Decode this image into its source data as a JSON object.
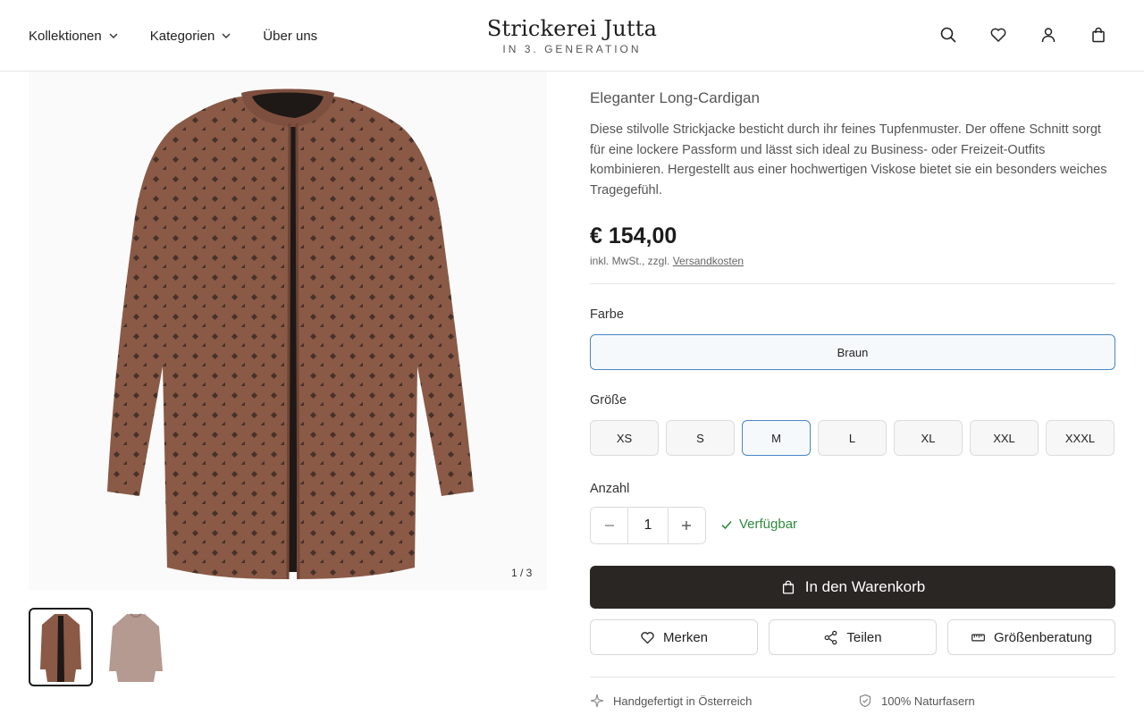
{
  "header": {
    "nav": [
      {
        "label": "Kollektionen",
        "has_dropdown": true
      },
      {
        "label": "Kategorien",
        "has_dropdown": true
      },
      {
        "label": "Über uns",
        "has_dropdown": false
      }
    ],
    "brand_name": "Strickerei Jutta",
    "brand_tagline": "IN 3. GENERATION",
    "icons": [
      "search-icon",
      "heart-icon",
      "user-icon",
      "shopping-bag-icon"
    ]
  },
  "gallery": {
    "counter": "1 / 3",
    "thumbnails": [
      {
        "icon": "cardigan-brown-thumbnail",
        "active": true
      },
      {
        "icon": "cardigan-beige-thumbnail",
        "active": false
      }
    ]
  },
  "product": {
    "subtitle": "Eleganter Long-Cardigan",
    "description": "Diese stilvolle Strickjacke besticht durch ihr feines Tupfenmuster. Der offene Schnitt sorgt für eine lockere Passform und lässt sich ideal zu Business- oder Freizeit-Outfits kombinieren. Hergestellt aus einer hochwertigen Viskose bietet sie ein besonders weiches Tragegefühl.",
    "price": "€ 154,00",
    "tax_note": "inkl. MwSt., zzgl.",
    "shipping_link": "Versandkosten",
    "color_label": "Farbe",
    "color_value": "Braun",
    "size_label": "Größe",
    "sizes": [
      "XS",
      "S",
      "M",
      "L",
      "XL",
      "XXL",
      "XXXL"
    ],
    "selected_size": "M",
    "quantity_label": "Anzahl",
    "quantity": "1",
    "availability": "Verfügbar",
    "cart_button": "In den Warenkorb",
    "actions": [
      {
        "label": "Merken",
        "icon": "heart-icon"
      },
      {
        "label": "Teilen",
        "icon": "share-icon"
      },
      {
        "label": "Größenberatung",
        "icon": "ruler-icon"
      }
    ],
    "features": [
      {
        "label": "Handgefertigt in Österreich",
        "icon": "sparkle-icon"
      },
      {
        "label": "100% Naturfasern",
        "icon": "shield-icon"
      }
    ]
  },
  "colors": {
    "accent_blue": "#4a86c5",
    "cart_button_bg": "#2a2624",
    "available_green": "#2e8b3e",
    "cardigan_brown": "#8a5a47"
  }
}
